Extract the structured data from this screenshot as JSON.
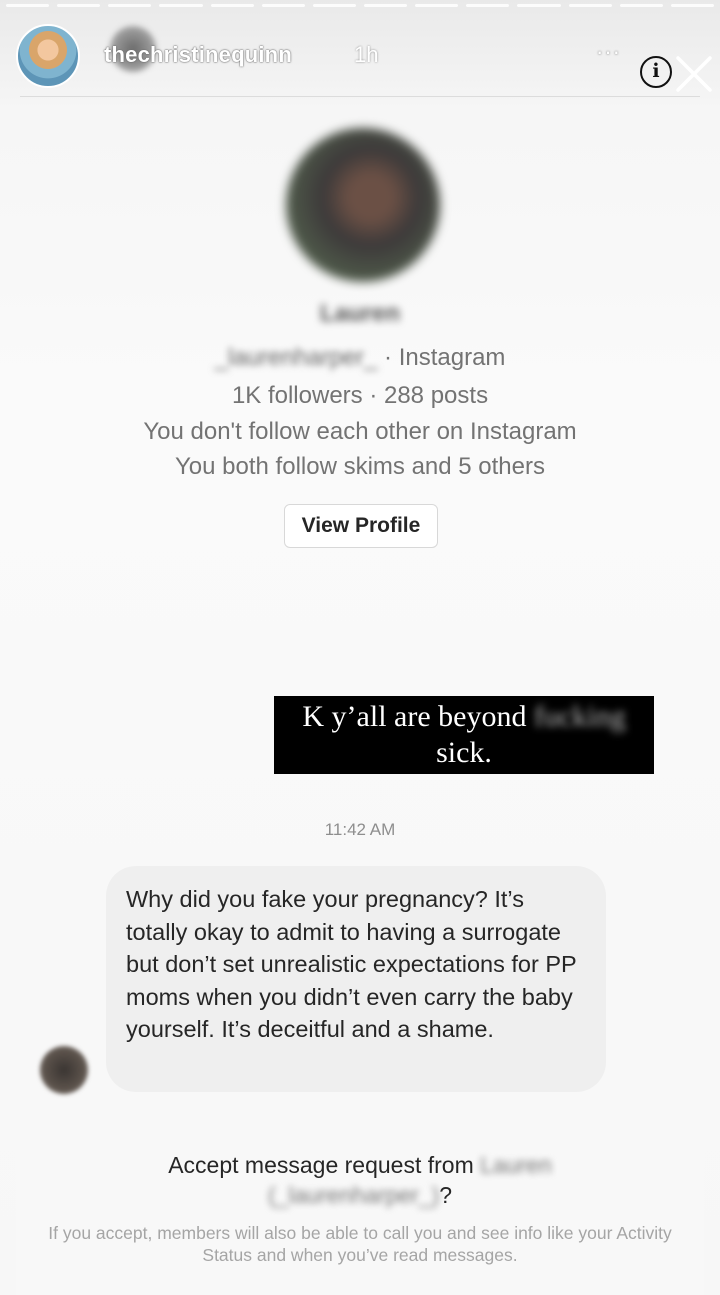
{
  "story": {
    "progress_segments": 14,
    "poster_username": "thechristinequinn",
    "post_time": "1h",
    "more_icon": "···",
    "info_icon": "i",
    "close_icon": "close-icon"
  },
  "profile": {
    "name": "Lauren",
    "handle": "_laurenharper_",
    "platform": "· Instagram",
    "stats": "1K followers · 288 posts",
    "follow_status": "You don't follow each other on Instagram",
    "mutuals": "You both follow skims and 5 others",
    "view_profile_label": "View Profile"
  },
  "thread": {
    "sent_quote_prefix": "K y’all are beyond ",
    "sent_quote_blurred": "fucking",
    "sent_quote_suffix": "sick.",
    "timestamp": "11:42 AM",
    "received_message": "Why did you fake your pregnancy? It’s totally okay to admit to having a surrogate but don’t set unrealistic expectations for PP moms when you didn’t even carry the baby yourself. It’s deceitful and a shame."
  },
  "request": {
    "title_prefix": "Accept message request from ",
    "sender_name": "Lauren",
    "sender_handle": "(_laurenharper_)",
    "title_suffix": "?",
    "note": "If you accept, members will also be able to call you and see info like your Activity Status and when you’ve read messages."
  },
  "colors": {
    "secondary_text": "#737373",
    "bubble_bg": "#efefef",
    "quote_bg": "#000000"
  }
}
